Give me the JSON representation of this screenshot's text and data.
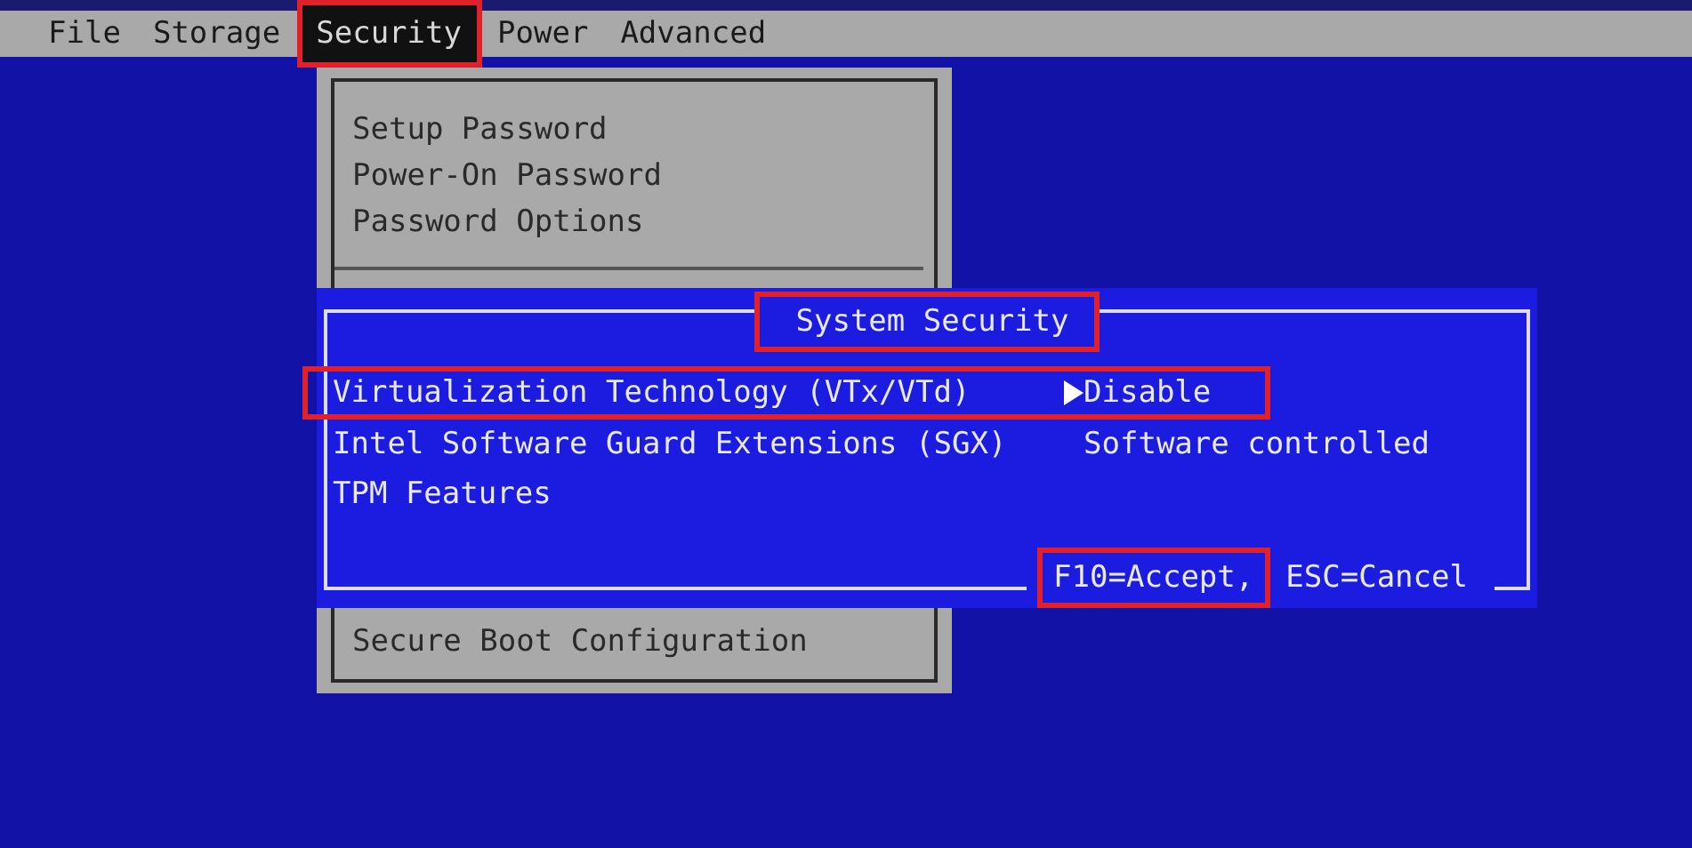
{
  "menu_bar": {
    "items": [
      {
        "label": "File",
        "selected": false,
        "highlighted": false
      },
      {
        "label": "Storage",
        "selected": false,
        "highlighted": false
      },
      {
        "label": "Security",
        "selected": true,
        "highlighted": true
      },
      {
        "label": "Power",
        "selected": false,
        "highlighted": false
      },
      {
        "label": "Advanced",
        "selected": false,
        "highlighted": false
      }
    ]
  },
  "menu": {
    "items": [
      {
        "kind": "item",
        "label": "Setup Password"
      },
      {
        "kind": "item",
        "label": "Power-On Password"
      },
      {
        "kind": "item",
        "label": "Password Options"
      },
      {
        "kind": "separator"
      },
      {
        "kind": "gap"
      },
      {
        "kind": "item",
        "label": "Secure Boot Configuration"
      }
    ]
  },
  "dialog": {
    "title": "System Security",
    "title_highlighted": true,
    "rows": [
      {
        "label": "Virtualization Technology (VTx/VTd)",
        "value": "Disable",
        "selected": true,
        "highlighted": true
      },
      {
        "label": "Intel Software Guard Extensions (SGX)",
        "value": "Software controlled",
        "selected": false,
        "highlighted": false
      },
      {
        "label": "TPM Features",
        "selected": false,
        "highlighted": false
      }
    ],
    "footer": [
      {
        "text": "F10=Accept,",
        "highlighted": true
      },
      {
        "text": "ESC=Cancel",
        "highlighted": false
      }
    ]
  }
}
